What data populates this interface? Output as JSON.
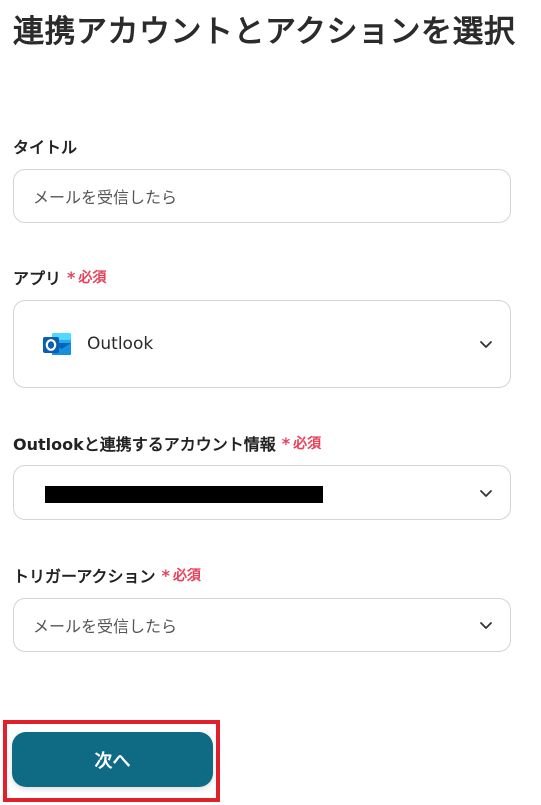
{
  "page": {
    "title": "連携アカウントとアクションを選択"
  },
  "form": {
    "title_field": {
      "label": "タイトル",
      "value": "メールを受信したら"
    },
    "app_field": {
      "label": "アプリ",
      "required_mark": "*",
      "required_text": "必須",
      "value": "Outlook",
      "icon": "outlook-logo"
    },
    "account_field": {
      "label": "Outlookと連携するアカウント情報",
      "required_mark": "*",
      "required_text": "必須",
      "value_redacted": true
    },
    "trigger_field": {
      "label": "トリガーアクション",
      "required_mark": "*",
      "required_text": "必須",
      "value": "メールを受信したら"
    }
  },
  "actions": {
    "next_label": "次へ"
  },
  "colors": {
    "primary": "#0f6b84",
    "required": "#e8415a",
    "highlight": "#e0202a",
    "border": "#d4d4d4"
  }
}
